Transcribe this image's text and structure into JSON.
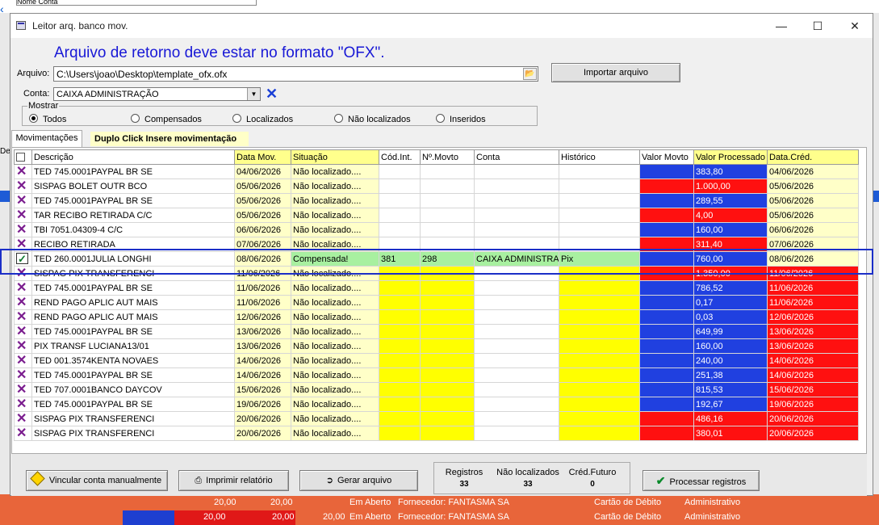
{
  "background": {
    "top_label": "Nome Conta",
    "left_header": "De",
    "bottom_rows": [
      {
        "v1": "20,00",
        "v2": "20,00",
        "status": "Em Aberto",
        "forn": "Fornecedor: FANTASMA SA",
        "forma": "Cartão de Débito",
        "cat": "Administrativo"
      },
      {
        "v1": "20,00",
        "v2": "20,00",
        "v3": "20,00",
        "status": "Em Aberto",
        "forn": "Fornecedor: FANTASMA SA",
        "forma": "Cartão de Débito",
        "cat": "Administrativo"
      }
    ]
  },
  "window": {
    "title": "Leitor arq. banco mov.",
    "minimize": "—",
    "maximize": "☐",
    "close": "✕"
  },
  "headline": "Arquivo de retorno deve estar no formato \"OFX\".",
  "file": {
    "label": "Arquivo:",
    "value": "C:\\Users\\joao\\Desktop\\template_ofx.ofx",
    "folder_icon": "📂",
    "import_button": "Importar arquivo"
  },
  "account": {
    "label": "Conta:",
    "value": "CAIXA ADMINISTRAÇÃO",
    "dropdown": "▼",
    "clear": "✕"
  },
  "show": {
    "legend": "Mostrar",
    "options": [
      "Todos",
      "Compensados",
      "Localizados",
      "Não localizados",
      "Inseridos"
    ],
    "selected": "Todos"
  },
  "tab": {
    "label": "Movimentações",
    "hint": "Duplo Click Insere movimentação"
  },
  "grid": {
    "headers": [
      "Descrição",
      "Data Mov.",
      "Situação",
      "Cód.Int.",
      "Nº.Movto",
      "Conta",
      "Histórico",
      "Valor Movto",
      "Valor Processado",
      "Data.Créd."
    ],
    "rows": [
      {
        "mark": "x",
        "desc": "TED 745.0001PAYPAL BR SE",
        "data": "04/06/2026",
        "sit": "Não localizado....",
        "cod": "",
        "nmov": "",
        "conta": "",
        "hist": "",
        "valmov": "",
        "valproc": "383,80",
        "cred": "04/06/2026",
        "vmcolor": "#2040e0",
        "vpcolor": "#2040e0",
        "credcolor": "#ffffc8",
        "midcolor": "#ffffff"
      },
      {
        "mark": "x",
        "desc": "SISPAG  BOLET OUTR BCO",
        "data": "05/06/2026",
        "sit": "Não localizado....",
        "cod": "",
        "nmov": "",
        "conta": "",
        "hist": "",
        "valmov": "",
        "valproc": "1.000,00",
        "cred": "05/06/2026",
        "vmcolor": "#ff1010",
        "vpcolor": "#ff1010",
        "credcolor": "#ffffc8",
        "midcolor": "#ffffff"
      },
      {
        "mark": "x",
        "desc": "TED 745.0001PAYPAL BR SE",
        "data": "05/06/2026",
        "sit": "Não localizado....",
        "cod": "",
        "nmov": "",
        "conta": "",
        "hist": "",
        "valmov": "",
        "valproc": "289,55",
        "cred": "05/06/2026",
        "vmcolor": "#2040e0",
        "vpcolor": "#2040e0",
        "credcolor": "#ffffc8",
        "midcolor": "#ffffff"
      },
      {
        "mark": "x",
        "desc": "TAR RECIBO RETIRADA C/C",
        "data": "05/06/2026",
        "sit": "Não localizado....",
        "cod": "",
        "nmov": "",
        "conta": "",
        "hist": "",
        "valmov": "",
        "valproc": "4,00",
        "cred": "05/06/2026",
        "vmcolor": "#ff1010",
        "vpcolor": "#ff1010",
        "credcolor": "#ffffc8",
        "midcolor": "#ffffff"
      },
      {
        "mark": "x",
        "desc": "TBI 7051.04309-4      C/C",
        "data": "06/06/2026",
        "sit": "Não localizado....",
        "cod": "",
        "nmov": "",
        "conta": "",
        "hist": "",
        "valmov": "",
        "valproc": "160,00",
        "cred": "06/06/2026",
        "vmcolor": "#2040e0",
        "vpcolor": "#2040e0",
        "credcolor": "#ffffc8",
        "midcolor": "#ffffff"
      },
      {
        "mark": "x",
        "desc": "RECIBO RETIRADA",
        "data": "07/06/2026",
        "sit": "Não localizado....",
        "cod": "",
        "nmov": "",
        "conta": "",
        "hist": "",
        "valmov": "",
        "valproc": "311,40",
        "cred": "07/06/2026",
        "vmcolor": "#ff1010",
        "vpcolor": "#ff1010",
        "credcolor": "#ffffc8",
        "midcolor": "#ffffff"
      },
      {
        "mark": "ok",
        "desc": "TED 260.0001JULIA LONGHI",
        "data": "08/06/2026",
        "sit": "Compensada!",
        "cod": "381",
        "nmov": "298",
        "conta": "CAIXA ADMINISTRA",
        "hist": "Pix",
        "valmov": "",
        "valproc": "760,00",
        "cred": "08/06/2026",
        "vmcolor": "#2040e0",
        "vpcolor": "#2040e0",
        "credcolor": "#ffffc8",
        "midcolor": "#a8f0a0"
      },
      {
        "mark": "x",
        "desc": "SISPAG  PIX TRANSFERENCI",
        "data": "11/06/2026",
        "sit": "Não localizado....",
        "cod": "",
        "nmov": "",
        "conta": "",
        "hist": "",
        "valmov": "",
        "valproc": "1.350,00",
        "cred": "11/06/2026",
        "vmcolor": "#ff1010",
        "vpcolor": "#ff1010",
        "credcolor": "#ff1010",
        "midcolor": "#ffff00"
      },
      {
        "mark": "x",
        "desc": "TED 745.0001PAYPAL BR SE",
        "data": "11/06/2026",
        "sit": "Não localizado....",
        "cod": "",
        "nmov": "",
        "conta": "",
        "hist": "",
        "valmov": "",
        "valproc": "786,52",
        "cred": "11/06/2026",
        "vmcolor": "#2040e0",
        "vpcolor": "#2040e0",
        "credcolor": "#ff1010",
        "midcolor": "#ffff00"
      },
      {
        "mark": "x",
        "desc": "REND PAGO APLIC AUT MAIS",
        "data": "11/06/2026",
        "sit": "Não localizado....",
        "cod": "",
        "nmov": "",
        "conta": "",
        "hist": "",
        "valmov": "",
        "valproc": "0,17",
        "cred": "11/06/2026",
        "vmcolor": "#2040e0",
        "vpcolor": "#2040e0",
        "credcolor": "#ff1010",
        "midcolor": "#ffff00"
      },
      {
        "mark": "x",
        "desc": "REND PAGO APLIC AUT MAIS",
        "data": "12/06/2026",
        "sit": "Não localizado....",
        "cod": "",
        "nmov": "",
        "conta": "",
        "hist": "",
        "valmov": "",
        "valproc": "0,03",
        "cred": "12/06/2026",
        "vmcolor": "#2040e0",
        "vpcolor": "#2040e0",
        "credcolor": "#ff1010",
        "midcolor": "#ffff00"
      },
      {
        "mark": "x",
        "desc": "TED 745.0001PAYPAL BR SE",
        "data": "13/06/2026",
        "sit": "Não localizado....",
        "cod": "",
        "nmov": "",
        "conta": "",
        "hist": "",
        "valmov": "",
        "valproc": "649,99",
        "cred": "13/06/2026",
        "vmcolor": "#2040e0",
        "vpcolor": "#2040e0",
        "credcolor": "#ff1010",
        "midcolor": "#ffff00"
      },
      {
        "mark": "x",
        "desc": "PIX TRANSF  LUCIANA13/01",
        "data": "13/06/2026",
        "sit": "Não localizado....",
        "cod": "",
        "nmov": "",
        "conta": "",
        "hist": "",
        "valmov": "",
        "valproc": "160,00",
        "cred": "13/06/2026",
        "vmcolor": "#2040e0",
        "vpcolor": "#2040e0",
        "credcolor": "#ff1010",
        "midcolor": "#ffff00"
      },
      {
        "mark": "x",
        "desc": "TED 001.3574KENTA NOVAES",
        "data": "14/06/2026",
        "sit": "Não localizado....",
        "cod": "",
        "nmov": "",
        "conta": "",
        "hist": "",
        "valmov": "",
        "valproc": "240,00",
        "cred": "14/06/2026",
        "vmcolor": "#2040e0",
        "vpcolor": "#2040e0",
        "credcolor": "#ff1010",
        "midcolor": "#ffff00"
      },
      {
        "mark": "x",
        "desc": "TED 745.0001PAYPAL BR SE",
        "data": "14/06/2026",
        "sit": "Não localizado....",
        "cod": "",
        "nmov": "",
        "conta": "",
        "hist": "",
        "valmov": "",
        "valproc": "251,38",
        "cred": "14/06/2026",
        "vmcolor": "#2040e0",
        "vpcolor": "#2040e0",
        "credcolor": "#ff1010",
        "midcolor": "#ffff00"
      },
      {
        "mark": "x",
        "desc": "TED 707.0001BANCO DAYCOV",
        "data": "15/06/2026",
        "sit": "Não localizado....",
        "cod": "",
        "nmov": "",
        "conta": "",
        "hist": "",
        "valmov": "",
        "valproc": "815,53",
        "cred": "15/06/2026",
        "vmcolor": "#2040e0",
        "vpcolor": "#2040e0",
        "credcolor": "#ff1010",
        "midcolor": "#ffff00"
      },
      {
        "mark": "x",
        "desc": "TED 745.0001PAYPAL BR SE",
        "data": "19/06/2026",
        "sit": "Não localizado....",
        "cod": "",
        "nmov": "",
        "conta": "",
        "hist": "",
        "valmov": "",
        "valproc": "192,67",
        "cred": "19/06/2026",
        "vmcolor": "#2040e0",
        "vpcolor": "#2040e0",
        "credcolor": "#ff1010",
        "midcolor": "#ffff00"
      },
      {
        "mark": "x",
        "desc": "SISPAG  PIX TRANSFERENCI",
        "data": "20/06/2026",
        "sit": "Não localizado....",
        "cod": "",
        "nmov": "",
        "conta": "",
        "hist": "",
        "valmov": "",
        "valproc": "486,16",
        "cred": "20/06/2026",
        "vmcolor": "#ff1010",
        "vpcolor": "#ff1010",
        "credcolor": "#ff1010",
        "midcolor": "#ffff00"
      },
      {
        "mark": "x",
        "desc": "SISPAG  PIX TRANSFERENCI",
        "data": "20/06/2026",
        "sit": "Não localizado....",
        "cod": "",
        "nmov": "",
        "conta": "",
        "hist": "",
        "valmov": "",
        "valproc": "380,01",
        "cred": "20/06/2026",
        "vmcolor": "#ff1010",
        "vpcolor": "#ff1010",
        "credcolor": "#ff1010",
        "midcolor": "#ffff00"
      }
    ]
  },
  "footer": {
    "link_button": "Vincular conta manualmente",
    "print_button": "Imprimir relatório",
    "generate_button": "Gerar arquivo",
    "process_button": "Processar registros",
    "stats": [
      {
        "label": "Registros",
        "value": "33"
      },
      {
        "label": "Não localizados",
        "value": "33"
      },
      {
        "label": "Créd.Futuro",
        "value": "0"
      }
    ]
  }
}
